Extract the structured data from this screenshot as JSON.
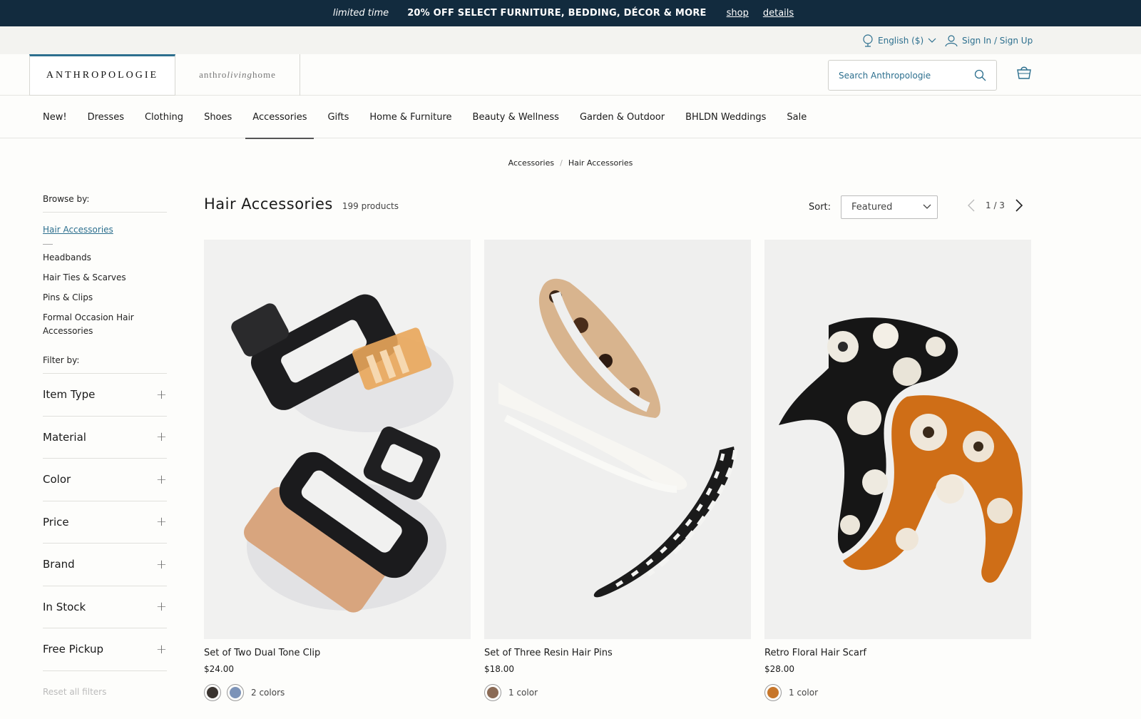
{
  "promo": {
    "tag": "limited time",
    "message": "20% OFF SELECT FURNITURE, BEDDING, DÉCOR & MORE",
    "shop_link": "shop",
    "details_link": "details"
  },
  "utility": {
    "language": "English ($)",
    "sign_in": "Sign In / Sign Up"
  },
  "header": {
    "brand": "ANTHROPOLOGIE",
    "living_left": "anthro",
    "living_mid": "living",
    "living_right": "home",
    "search_placeholder": "Search Anthropologie"
  },
  "nav": {
    "items": [
      "New!",
      "Dresses",
      "Clothing",
      "Shoes",
      "Accessories",
      "Gifts",
      "Home & Furniture",
      "Beauty & Wellness",
      "Garden & Outdoor",
      "BHLDN Weddings",
      "Sale"
    ],
    "active": "Accessories"
  },
  "breadcrumb": {
    "parent": "Accessories",
    "sep": "/",
    "current": "Hair Accessories"
  },
  "sidebar": {
    "browse_label": "Browse by:",
    "current_category": "Hair Accessories",
    "subcategories": [
      "Headbands",
      "Hair Ties & Scarves",
      "Pins & Clips",
      "Formal Occasion Hair Accessories"
    ],
    "filter_label": "Filter by:",
    "facets": [
      "Item Type",
      "Material",
      "Color",
      "Price",
      "Brand",
      "In Stock",
      "Free Pickup"
    ],
    "plus": "+",
    "reset": "Reset all filters"
  },
  "main": {
    "title": "Hair Accessories",
    "count": "199 products",
    "sort_label": "Sort:",
    "sort_value": "Featured",
    "page": "1 / 3"
  },
  "products": [
    {
      "name": "Set of Two Dual Tone Clip",
      "price": "$24.00",
      "colors_text": "2 colors",
      "swatches": [
        "#3a3430",
        "#7c93b8"
      ]
    },
    {
      "name": "Set of Three Resin Hair Pins",
      "price": "$18.00",
      "colors_text": "1 color",
      "swatches": [
        "#8a6a55"
      ]
    },
    {
      "name": "Retro Floral Hair Scarf",
      "price": "$28.00",
      "colors_text": "1 color",
      "swatches": [
        "#c7762a"
      ]
    }
  ],
  "colors": {
    "promo_bg": "#122b3e",
    "accent": "#2c6f8e"
  }
}
